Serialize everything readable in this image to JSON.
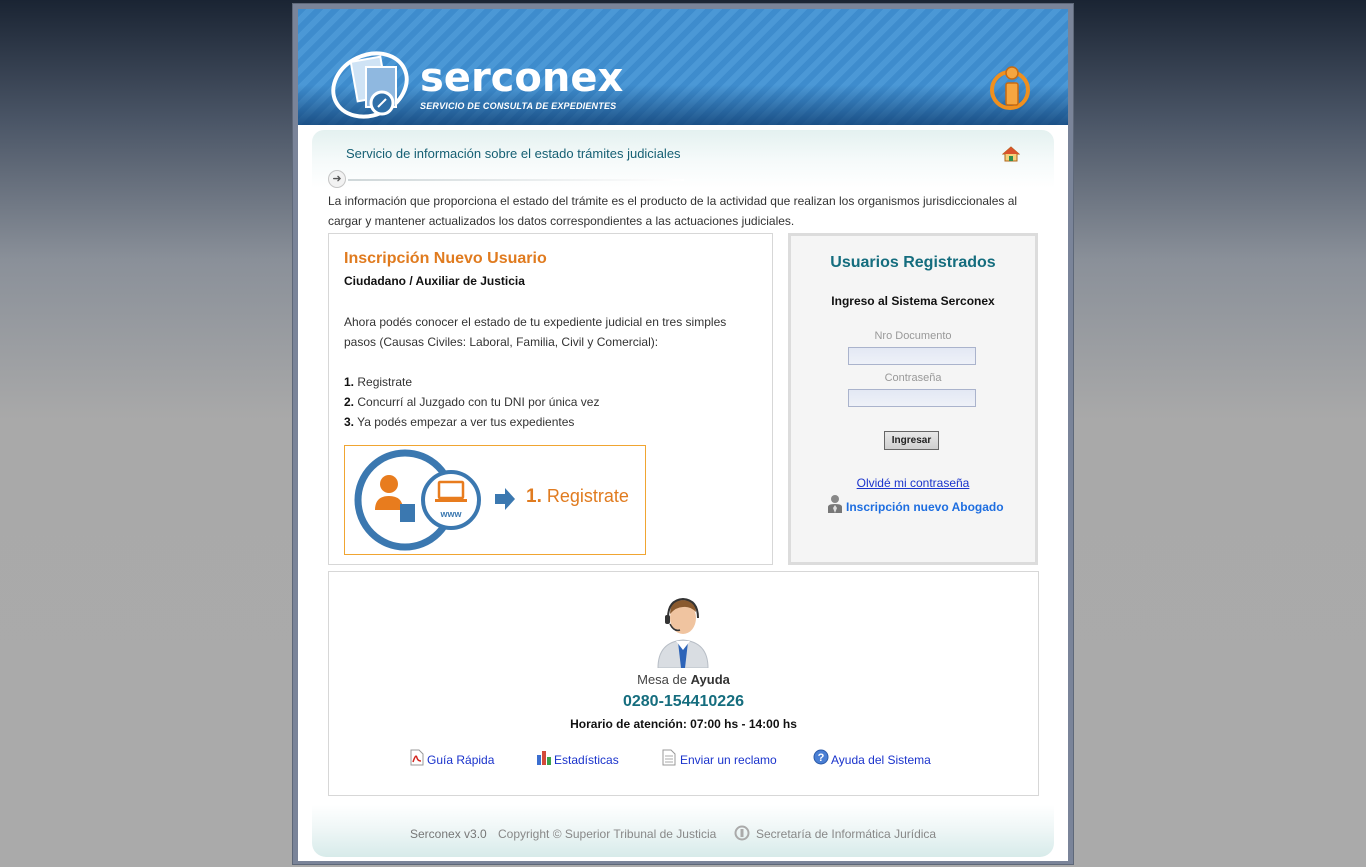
{
  "brand": {
    "name": "serconex",
    "tagline": "SERVICIO DE CONSULTA DE EXPEDIENTES"
  },
  "subheader": {
    "title": "Servicio de información sobre el estado trámites judiciales"
  },
  "intro": "La información que proporciona el estado del trámite es el producto de la actividad que realizan los organismos jurisdiccionales al cargar y mantener actualizados los datos correspondientes a las actuaciones judiciales.",
  "registration": {
    "title": "Inscripción Nuevo Usuario",
    "subtitle": "Ciudadano / Auxiliar de Justicia",
    "body": "Ahora podés conocer el estado de tu expediente judicial en tres simples pasos (Causas Civiles: Laboral, Familia, Civil y Comercial):",
    "steps": [
      {
        "num": "1.",
        "text": "Registrate"
      },
      {
        "num": "2.",
        "text": "Concurrí al Juzgado con tu DNI por única vez"
      },
      {
        "num": "3.",
        "text": "Ya podés empezar a ver tus expedientes"
      }
    ],
    "banner_step_num": "1.",
    "banner_step_text": "Registrate",
    "banner_www": "www"
  },
  "login": {
    "title": "Usuarios Registrados",
    "subtitle": "Ingreso al Sistema Serconex",
    "doc_label": "Nro Documento",
    "doc_value": "",
    "password_label": "Contraseña",
    "password_value": "",
    "submit_label": "Ingresar",
    "forgot_label": "Olvidé mi contraseña",
    "lawyer_label": "Inscripción nuevo Abogado"
  },
  "help": {
    "title_light": "Mesa de",
    "title_bold": "Ayuda",
    "phone": "0280-154410226",
    "hours": "Horario de atención: 07:00 hs - 14:00 hs",
    "links": [
      {
        "label": "Guía Rápida",
        "icon": "pdf-icon"
      },
      {
        "label": "Estadísticas",
        "icon": "bar-chart-icon"
      },
      {
        "label": "Enviar un reclamo",
        "icon": "document-icon"
      },
      {
        "label": "Ayuda del Sistema",
        "icon": "help-icon"
      }
    ]
  },
  "footer": {
    "version": "Serconex v3.0",
    "copyright": "Copyright © Superior Tribunal de Justicia",
    "department": "Secretaría de Informática Jurídica"
  },
  "colors": {
    "accent_orange": "#e07b1f",
    "accent_teal": "#156d7e",
    "banner_blue": "#3e8ccd",
    "link_blue": "#1a33cc"
  }
}
